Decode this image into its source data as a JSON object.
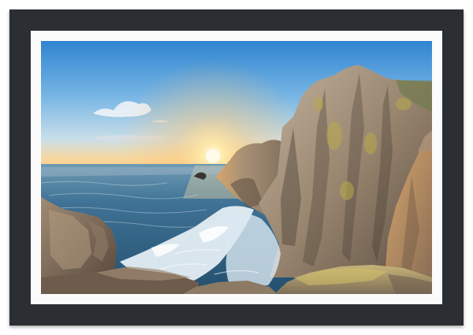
{
  "artwork": {
    "type": "framed-photograph",
    "frame_color": "#2b2f33",
    "mat_color": "#fbfbfb",
    "scene": {
      "sky_top": "#2f84d0",
      "sky_mid": "#8fc4ea",
      "horizon_glow": "#ffd18a",
      "sun": "#fff8d8",
      "sea_far": "#4b7fa1",
      "sea_near": "#2e5f7d",
      "foam": "#e8f2f7",
      "rock_light": "#b4a48c",
      "rock_mid": "#8a7764",
      "rock_dark": "#4e4237",
      "lichen": "#c8b54a"
    }
  }
}
